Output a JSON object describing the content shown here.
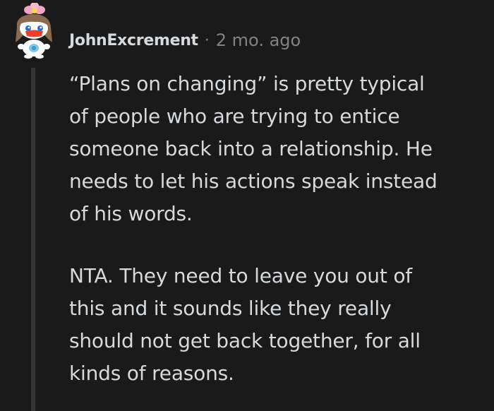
{
  "comment": {
    "author": "JohnExcrement",
    "separator": "·",
    "timestamp": "2 mo. ago",
    "paragraphs": [
      "“Plans on changing” is pretty typical\nof people who are trying to entice\nsomeone back into a relationship. He\nneeds to let his actions speak instead\nof his words.",
      "NTA. They need to leave you out of\nthis and it sounds like they really\nshould not get back together, for all\nkinds of reasons."
    ]
  },
  "colors": {
    "background": "#1a1a1b",
    "text": "#d7dadc",
    "meta": "#818384",
    "thread_line": "#343536"
  },
  "icons": {
    "avatar": "snoo-avatar-icon"
  }
}
